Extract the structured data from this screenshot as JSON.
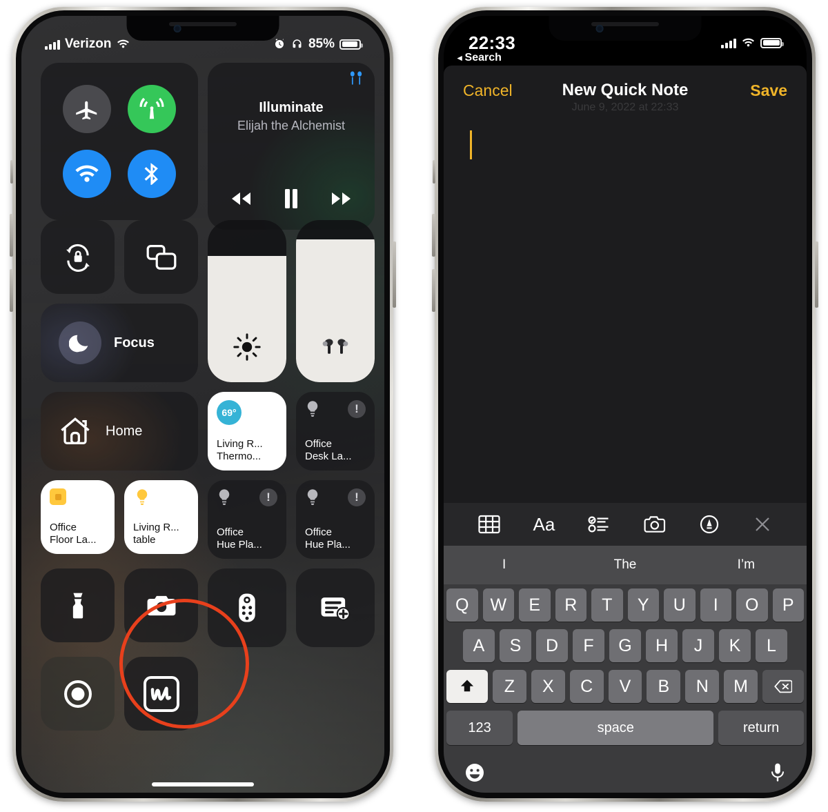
{
  "left_phone": {
    "status_bar": {
      "carrier": "Verizon",
      "signal_icon": "cellular-bars-icon",
      "wifi_icon": "wifi-icon",
      "alarm_icon": "alarm-clock-icon",
      "headphones_icon": "headphones-icon",
      "battery_percent": "85%",
      "battery_level": 85
    },
    "connectivity": [
      {
        "name": "airplane-mode",
        "icon": "airplane-icon",
        "active": false,
        "color": "#4a4a4e"
      },
      {
        "name": "cellular-data",
        "icon": "cellular-antenna-icon",
        "active": true,
        "color": "#35c759"
      },
      {
        "name": "wifi",
        "icon": "wifi-icon",
        "active": true,
        "color": "#1f8cf5"
      },
      {
        "name": "bluetooth",
        "icon": "bluetooth-icon",
        "active": true,
        "color": "#1f8cf5"
      }
    ],
    "media": {
      "track_title": "Illuminate",
      "artist": "Elijah the Alchemist",
      "route_icon": "airpods-icon",
      "route_color": "#2f9aff",
      "rewind_icon": "rewind-icon",
      "pause_icon": "pause-icon",
      "forward_icon": "fast-forward-icon"
    },
    "utility_small": [
      {
        "name": "rotation-lock",
        "icon": "rotation-lock-icon"
      },
      {
        "name": "screen-mirroring",
        "icon": "screen-mirroring-icon"
      }
    ],
    "focus": {
      "label": "Focus",
      "icon": "moon-icon"
    },
    "sliders": [
      {
        "name": "brightness",
        "icon": "sun-icon",
        "value": 78
      },
      {
        "name": "volume",
        "icon": "airpods-pro-icon",
        "value": 88
      }
    ],
    "home_header": {
      "label": "Home",
      "icon": "home-icon"
    },
    "accessories": [
      {
        "name": "living-room-thermostat",
        "line1": "Living R...",
        "line2": "Thermo...",
        "state": "on",
        "badge": "69°",
        "badge_color": "#35b3d6",
        "icon": "thermostat-badge"
      },
      {
        "name": "office-desk-lamp",
        "line1": "Office",
        "line2": "Desk La...",
        "state": "off",
        "icon": "bulb-icon",
        "warning": "!"
      },
      {
        "name": "office-floor-lamp",
        "line1": "Office",
        "line2": "Floor La...",
        "state": "on",
        "icon": "square-light-icon"
      },
      {
        "name": "living-room-table",
        "line1": "Living R...",
        "line2": "table",
        "state": "on",
        "icon": "bulb-icon"
      },
      {
        "name": "office-hue-play-1",
        "line1": "Office",
        "line2": "Hue Pla...",
        "state": "off",
        "icon": "bulb-icon",
        "warning": "!"
      },
      {
        "name": "office-hue-play-2",
        "line1": "Office",
        "line2": "Hue Pla...",
        "state": "off",
        "icon": "bulb-icon",
        "warning": "!"
      }
    ],
    "utilities": [
      {
        "name": "flashlight",
        "icon": "flashlight-icon"
      },
      {
        "name": "camera",
        "icon": "camera-icon"
      },
      {
        "name": "apple-tv-remote",
        "icon": "remote-icon"
      },
      {
        "name": "quick-note-shortcut",
        "icon": "note-plus-icon"
      },
      {
        "name": "screen-recording",
        "icon": "record-icon"
      },
      {
        "name": "quick-note",
        "icon": "quick-note-icon",
        "highlighted": true
      }
    ],
    "annotation": {
      "shape": "circle",
      "color": "#e8401c",
      "target": "quick-note"
    }
  },
  "right_phone": {
    "status_bar": {
      "time": "22:33",
      "back_label": "Search",
      "back_icon": "triangle-left-icon",
      "signal_icon": "cellular-bars-icon",
      "wifi_icon": "wifi-icon",
      "battery_level": 92
    },
    "nav": {
      "cancel_label": "Cancel",
      "title": "New Quick Note",
      "save_label": "Save"
    },
    "note": {
      "datestamp": "June 9, 2022 at 22:33",
      "body": "",
      "cursor_visible": true,
      "accent_color": "#f0b429"
    },
    "toolbar": [
      {
        "name": "table-tool",
        "icon": "table-icon"
      },
      {
        "name": "format-tool",
        "icon": "aa-icon",
        "label": "Aa"
      },
      {
        "name": "checklist-tool",
        "icon": "checklist-icon"
      },
      {
        "name": "camera-tool",
        "icon": "camera-icon"
      },
      {
        "name": "markup-tool",
        "icon": "markup-pen-icon"
      },
      {
        "name": "close-toolbar",
        "icon": "close-icon"
      }
    ],
    "predictions": [
      "I",
      "The",
      "I’m"
    ],
    "keyboard": {
      "row1": [
        "Q",
        "W",
        "E",
        "R",
        "T",
        "Y",
        "U",
        "I",
        "O",
        "P"
      ],
      "row2": [
        "A",
        "S",
        "D",
        "F",
        "G",
        "H",
        "J",
        "K",
        "L"
      ],
      "row3": [
        "Z",
        "X",
        "C",
        "V",
        "B",
        "N",
        "M"
      ],
      "shift": {
        "name": "shift-key",
        "icon": "shift-arrow-icon",
        "active": true
      },
      "backspace": {
        "name": "backspace-key",
        "icon": "backspace-icon"
      },
      "numbers_label": "123",
      "space_label": "space",
      "return_label": "return",
      "emoji_icon": "emoji-smiley-icon",
      "dictation_icon": "microphone-icon"
    }
  }
}
